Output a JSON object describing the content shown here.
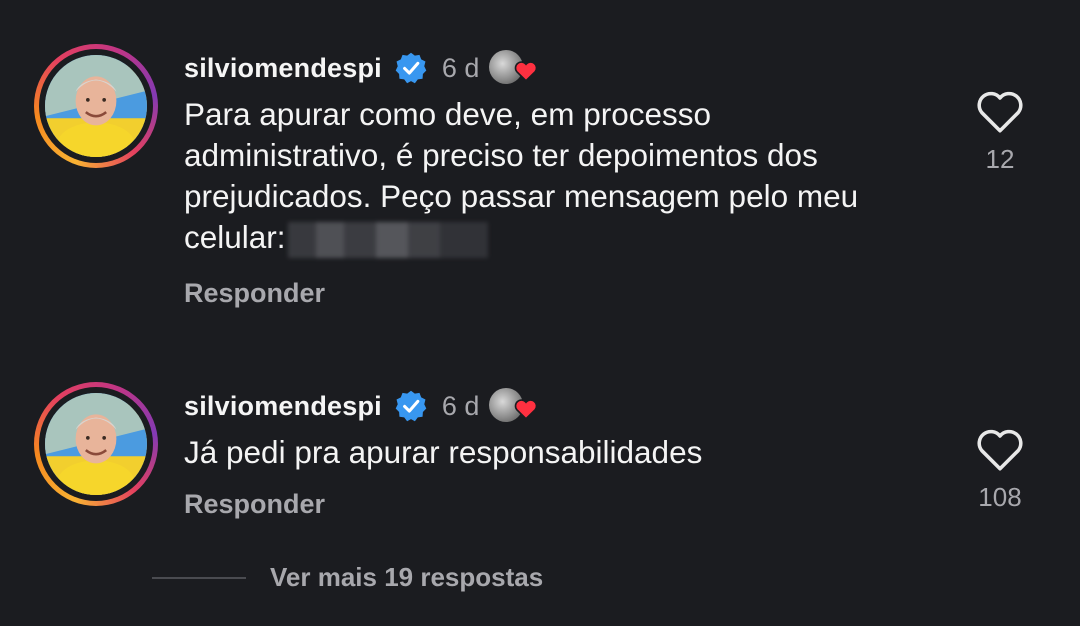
{
  "comments": [
    {
      "username": "silviomendespi",
      "time": "6 d",
      "text": "Para apurar como deve, em processo administrativo, é preciso ter depoimentos dos prejudicados. Peço passar mensagem pelo meu celular:",
      "reply_label": "Responder",
      "like_count": "12"
    },
    {
      "username": "silviomendespi",
      "time": "6 d",
      "text": "Já pedi pra apurar responsabilidades",
      "reply_label": "Responder",
      "like_count": "108"
    }
  ],
  "view_more_label": "Ver mais 19 respostas",
  "colors": {
    "background": "#1b1c20",
    "verified_blue": "#3897f0",
    "heart_red": "#ff3040",
    "muted_text": "#a8a8ad"
  },
  "icons": [
    "verified-badge-icon",
    "heart-outline-icon",
    "creator-liked-heart-icon"
  ]
}
